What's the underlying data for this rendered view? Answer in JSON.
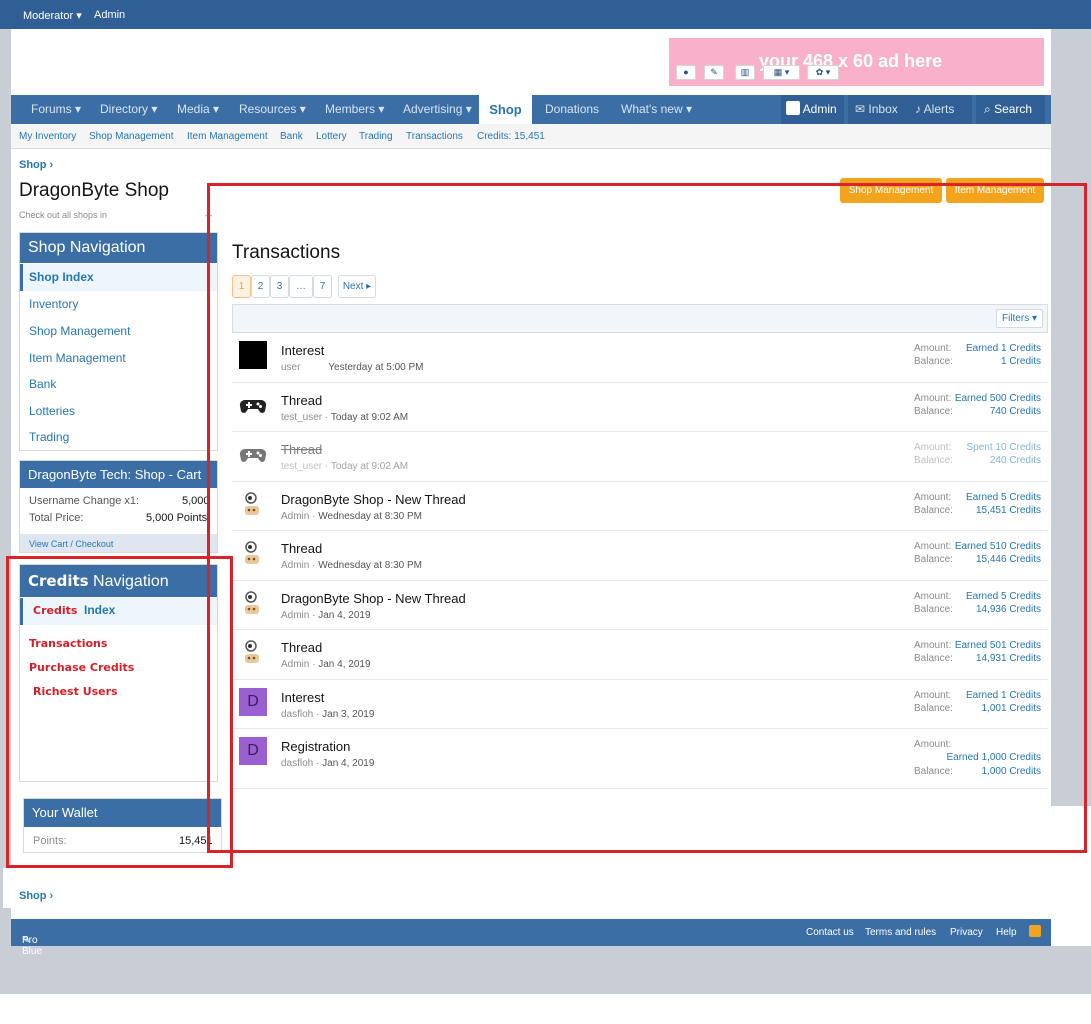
{
  "topbar": {
    "moderator": "Moderator ▾",
    "admin": "Admin"
  },
  "ad": {
    "text": "your 468 x 60 ad here"
  },
  "nav": {
    "items": [
      {
        "label": "Forums ▾"
      },
      {
        "label": "Directory ▾"
      },
      {
        "label": "Media ▾"
      },
      {
        "label": "Resources ▾"
      },
      {
        "label": "Members ▾"
      },
      {
        "label": "Advertising ▾"
      },
      {
        "label": "Shop"
      },
      {
        "label": "Donations"
      },
      {
        "label": "What's new ▾"
      }
    ],
    "right": {
      "admin": "Admin",
      "inbox": "Inbox",
      "alerts": "Alerts",
      "search": "Search"
    }
  },
  "subnav": [
    "My Inventory",
    "Shop Management",
    "Item Management",
    "Bank",
    "Lottery",
    "Trading",
    "Transactions",
    "Credits: 15,451"
  ],
  "breadcrumb": "Shop ›",
  "page": {
    "title": "DragonByte Shop",
    "subtitle": "Check out all shops in"
  },
  "buttons": {
    "shop_management": "Shop Management",
    "item_management": "Item Management"
  },
  "shop_nav": {
    "title": "Shop Navigation",
    "items": [
      "Shop Index",
      "Inventory",
      "Shop Management",
      "Item Management",
      "Bank",
      "Lotteries",
      "Trading"
    ]
  },
  "cart": {
    "title": "DragonByte Tech: Shop - Cart",
    "line_label": "Username Change x1:",
    "line_value": "5,000",
    "total_label": "Total Price:",
    "total_value": "5,000 Points",
    "link": "View Cart / Checkout"
  },
  "credits_nav": {
    "title_bold": "Credits",
    "title_rest": "Navigation",
    "index_a": "Credits",
    "index_b": "Index",
    "items": [
      "Transactions",
      "Purchase Credits",
      "Richest Users"
    ]
  },
  "wallet": {
    "title": "Your Wallet",
    "label": "Points:",
    "value": "15,451"
  },
  "transactions": {
    "title": "Transactions",
    "pages": [
      "1",
      "2",
      "3",
      "…",
      "7",
      "Next ▸"
    ],
    "filters": "Filters ▾",
    "amount_label": "Amount:",
    "balance_label": "Balance:",
    "rows": [
      {
        "title": "Interest",
        "user": "user",
        "date": "Yesterday at 5:00 PM",
        "amount": "Earned 1 Credits",
        "balance": "1 Credits"
      },
      {
        "title": "Thread",
        "user": "test_user",
        "date": "Today at 9:02 AM",
        "amount": "Earned 500 Credits",
        "balance": "740 Credits"
      },
      {
        "title": "Thread",
        "user": "test_user",
        "date": "Today at 9:02 AM",
        "amount": "Spent 10 Credits",
        "balance": "240 Credits"
      },
      {
        "title": "DragonByte Shop - New Thread",
        "user": "Admin",
        "date": "Wednesday at 8:30 PM",
        "amount": "Earned 5 Credits",
        "balance": "15,451 Credits"
      },
      {
        "title": "Thread",
        "user": "Admin",
        "date": "Wednesday at 8:30 PM",
        "amount": "Earned 510 Credits",
        "balance": "15,446 Credits"
      },
      {
        "title": "DragonByte Shop - New Thread",
        "user": "Admin",
        "date": "Jan 4, 2019",
        "amount": "Earned 5 Credits",
        "balance": "14,936 Credits"
      },
      {
        "title": "Thread",
        "user": "Admin",
        "date": "Jan 4, 2019",
        "amount": "Earned 501 Credits",
        "balance": "14,931 Credits"
      },
      {
        "title": "Interest",
        "user": "dasfloh",
        "date": "Jan 3, 2019",
        "amount": "Earned 1 Credits",
        "balance": "1,001 Credits",
        "avatar_letter": "D"
      },
      {
        "title": "Registration",
        "user": "dasfloh",
        "date": "Jan 4, 2019",
        "amount": "Earned 1,000 Credits",
        "balance": "1,000 Credits",
        "avatar_letter": "D"
      }
    ]
  },
  "footer_breadcrumb": "Shop ›",
  "footer": {
    "style": "Pro Blue",
    "contact": "Contact us",
    "terms": "Terms and rules",
    "privacy": "Privacy",
    "help": "Help"
  },
  "colors": {
    "nav": "#3a6ea5",
    "accent": "#f3a31c",
    "highlight": "#d8232a",
    "link": "#2577b1"
  }
}
